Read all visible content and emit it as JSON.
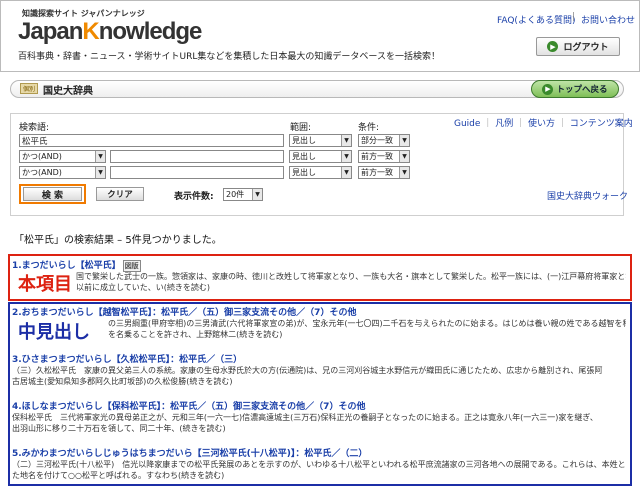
{
  "header": {
    "site_tag": "知識探索サイト ジャパンナレッジ",
    "logo_pre": "Japan",
    "logo_k": "K",
    "logo_post": "nowledge",
    "tagline": "百科事典・辞書・ニュース・学術サイトURL集などを集積した日本最大の知識データベースを一括検索！",
    "faq": "FAQ(よくある質問)",
    "contact": "お問い合わせ",
    "logout": "ログアウト"
  },
  "dict_bar": {
    "badge": "個別",
    "name": "国史大辞典",
    "top_button": "トップへ戻る"
  },
  "search": {
    "keyword_label": "検索語:",
    "range_label": "範囲:",
    "condition_label": "条件:",
    "rows": [
      {
        "op": "",
        "term": "松平氏",
        "range": "見出し",
        "cond": "部分一致"
      },
      {
        "op": "かつ(AND)",
        "term": "",
        "range": "見出し",
        "cond": "前方一致"
      },
      {
        "op": "かつ(AND)",
        "term": "",
        "range": "見出し",
        "cond": "前方一致"
      }
    ],
    "links": [
      "Guide",
      "凡例",
      "使い方",
      "コンテンツ案内"
    ],
    "search_button": "検 索",
    "clear_button": "クリア",
    "count_label": "表示件数:",
    "count_value": "20件",
    "walk_link": "国史大辞典ウォーク"
  },
  "results": {
    "summary": "「松平氏」の検索結果 – 5件見つかりました。",
    "items": [
      {
        "title": "1.まつだいらし【松平氏】",
        "badge": "図版",
        "lines": [
          "　　　　　　　　国で繁栄した武士の一族。惣領家は、家康の時、徳川と改姓して将軍家となり、一族も大名・旗本として繁栄した。松平一族には、(一)江戸幕府将軍家となった惣",
          "　　　　　　　　以前に成立していた、い(続きを読む)"
        ]
      },
      {
        "title": "2.おちまつだいらし【越智松平氏】：松平氏／（五）御三家支流その他／（7）その他",
        "lines": [
          "　　　　　　　　　　　　の三男綱重(甲府宰相)の三男清武(六代将軍家宣の弟)が、宝永元年(一七〇四)二千石を与えられたのに始まる。はじめは養い親の姓である越智を称す",
          "　　　　　　　　　　　　を名乗ることを許され、上野館林二(続きを読む)"
        ]
      },
      {
        "title": "3.ひさまつまつだいらし【久松松平氏】：松平氏／（三）",
        "lines": [
          "（三）久松松平氏　家康の異父弟三人の系統。家康の生母水野氏於大の方(伝通院)は、兄の三河刈谷城主水野信元が織田氏に通じたため、広忠から離別され、尾張阿",
          "古居城主(愛知県知多郡阿久比町坂部)の久松俊勝(続きを読む)"
        ]
      },
      {
        "title": "4.ほしなまつだいらし【保科松平氏】：松平氏／（五）御三家支流その他／（7）その他",
        "lines": [
          "保科松平氏　三代将軍家光の異母弟正之が、元和三年(一六一七)信濃高遠城主(三万石)保科正光の養嗣子となったのに始まる。正之は寛永八年(一六三一)家を継ぎ、",
          "出羽山形に移り二十万石を領して、同二十年、(続きを読む)"
        ]
      },
      {
        "title": "5.みかわまつだいらしじゅうはちまつだいら【三河松平氏(十八松平)】：松平氏／（二）",
        "lines": [
          "（二）三河松平氏(十八松平)　信光以降家康までの松平氏発展のあとを示すのが、いわゆる十八松平といわれる松平庶流諸家の三河各地への展開である。これらは、本姓とし",
          "た地名を付けて○○松平と呼ばれる。すなわち(続きを読む)"
        ]
      }
    ]
  },
  "annotations": {
    "red": "本項目",
    "blue": "中見出し"
  },
  "colors": {
    "link": "#1a3fa8",
    "accent_orange": "#f07a00",
    "annotation_red": "#d21",
    "annotation_blue": "#1c2ea6"
  }
}
